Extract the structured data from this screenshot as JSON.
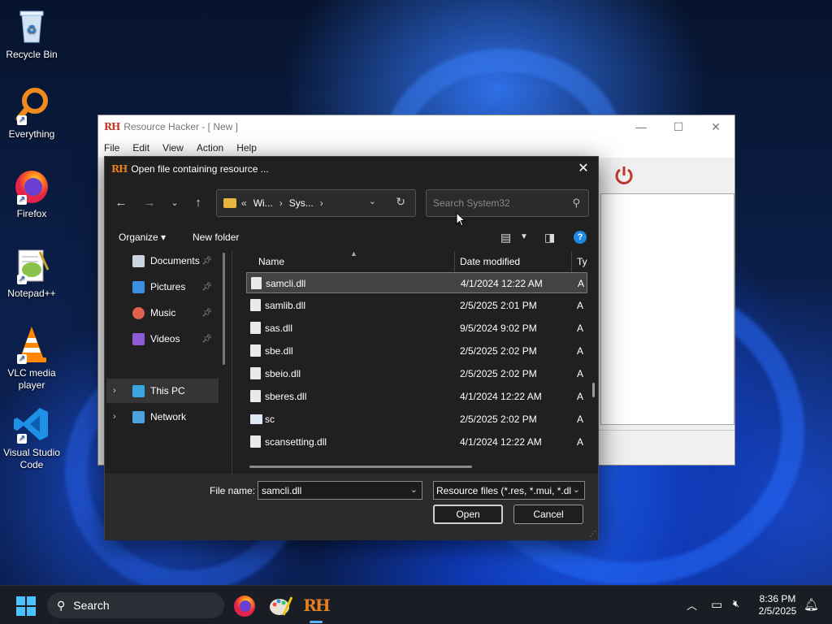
{
  "desktop": {
    "icons": [
      {
        "label": "Recycle Bin"
      },
      {
        "label": "Everything"
      },
      {
        "label": "Firefox"
      },
      {
        "label": "Notepad++"
      },
      {
        "label": "VLC media player"
      },
      {
        "label": "Visual Studio Code"
      }
    ]
  },
  "rh_window": {
    "logo": "RH",
    "title": "Resource Hacker - [ New ]",
    "menu": [
      "File",
      "Edit",
      "View",
      "Action",
      "Help"
    ],
    "power_color": "#c0392b"
  },
  "dialog": {
    "logo": "RH",
    "title": "Open file containing resource ...",
    "close_glyph": "✕",
    "address": {
      "prefix": "«",
      "segments": [
        "Wi...",
        "Sys..."
      ]
    },
    "search_placeholder": "Search System32",
    "commands": {
      "organize": "Organize ▾",
      "new_folder": "New folder",
      "help": "?"
    },
    "nav_items": [
      {
        "label": "Documents",
        "icon": "documents-icon",
        "pinned": true
      },
      {
        "label": "Pictures",
        "icon": "pictures-icon",
        "pinned": true
      },
      {
        "label": "Music",
        "icon": "music-icon",
        "pinned": true
      },
      {
        "label": "Videos",
        "icon": "videos-icon",
        "pinned": true
      },
      {
        "label": "This PC",
        "icon": "this-pc-icon",
        "pinned": false
      },
      {
        "label": "Network",
        "icon": "network-icon",
        "pinned": false
      }
    ],
    "columns": {
      "name": "Name",
      "date": "Date modified",
      "type": "Ty"
    },
    "files": [
      {
        "name": "samcli.dll",
        "date": "4/1/2024 12:22 AM",
        "type": "A",
        "selected": true
      },
      {
        "name": "samlib.dll",
        "date": "2/5/2025 2:01 PM",
        "type": "A"
      },
      {
        "name": "sas.dll",
        "date": "9/5/2024 9:02 PM",
        "type": "A"
      },
      {
        "name": "sbe.dll",
        "date": "2/5/2025 2:02 PM",
        "type": "A"
      },
      {
        "name": "sbeio.dll",
        "date": "2/5/2025 2:02 PM",
        "type": "A"
      },
      {
        "name": "sberes.dll",
        "date": "4/1/2024 12:22 AM",
        "type": "A"
      },
      {
        "name": "sc",
        "date": "2/5/2025 2:02 PM",
        "type": "A"
      },
      {
        "name": "scansetting.dll",
        "date": "4/1/2024 12:22 AM",
        "type": "A"
      }
    ],
    "file_name_label": "File name:",
    "file_name_value": "samcli.dll",
    "filter_value": "Resource files (*.res, *.mui, *.dll",
    "open_label": "Open",
    "cancel_label": "Cancel"
  },
  "taskbar": {
    "search_label": "Search",
    "time": "8:36 PM",
    "date": "2/5/2025",
    "pinned_apps": [
      "firefox-icon",
      "paint-icon",
      "resource-hacker-icon"
    ],
    "rh_logo": "RH"
  }
}
